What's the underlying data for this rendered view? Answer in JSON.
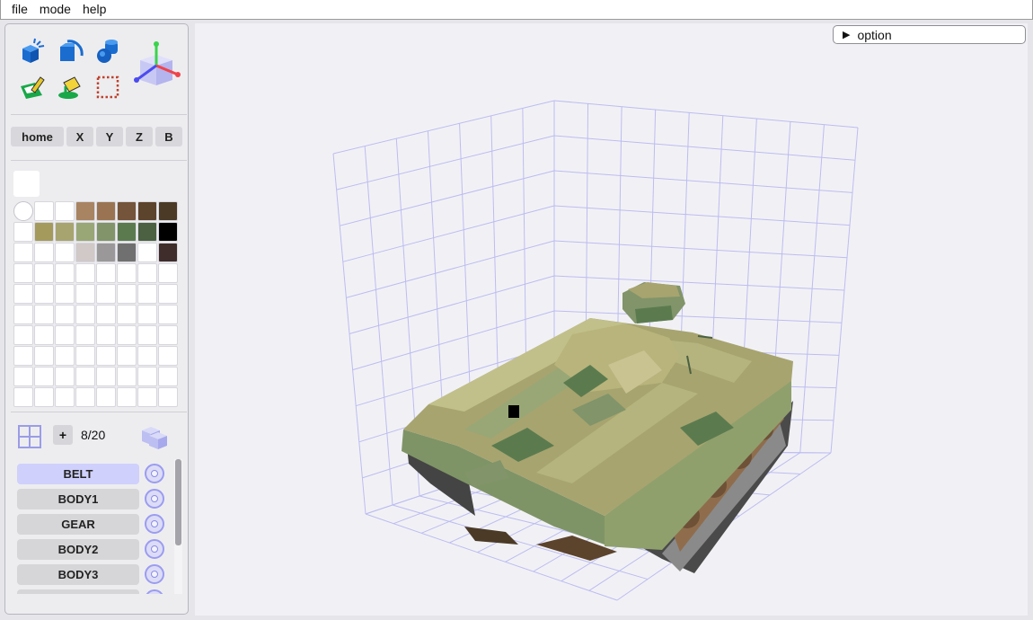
{
  "menu": {
    "file": "file",
    "mode": "mode",
    "help": "help"
  },
  "tools": [
    "add-voxel-icon",
    "rotate-icon",
    "cylinder-icon",
    "paint-icon",
    "fill-bucket-icon",
    "selection-rect-icon",
    "axis-gizmo-icon"
  ],
  "view_buttons": {
    "home": "home",
    "x": "X",
    "y": "Y",
    "z": "Z",
    "b": "B"
  },
  "current_color": "#ffffff",
  "palette": [
    "#ffffff",
    "#ffffff",
    "#ffffff",
    "#a88462",
    "#9a7452",
    "#74543a",
    "#5c432c",
    "#4b3a26",
    "#ffffff",
    "#a49a5c",
    "#a7a46f",
    "#99a776",
    "#81946a",
    "#5b7b4f",
    "#4b6142",
    "#000000",
    "#ffffff",
    "#ffffff",
    "#ffffff",
    "#d0c9c7",
    "#9a9898",
    "#707070",
    "#ffffff",
    "#3e2d2b"
  ],
  "palette_empty_rows": 7,
  "layers": {
    "add_label": "+",
    "count": "8/20",
    "items": [
      {
        "name": "BELT",
        "active": true
      },
      {
        "name": "BODY1",
        "active": false
      },
      {
        "name": "GEAR",
        "active": false
      },
      {
        "name": "BODY2",
        "active": false
      },
      {
        "name": "BODY3",
        "active": false
      },
      {
        "name": "",
        "active": false
      }
    ]
  },
  "option_label": "option",
  "colors": {
    "accent": "#cfd0fb",
    "grid": "#bcbcf2",
    "panel": "#ededf0"
  }
}
